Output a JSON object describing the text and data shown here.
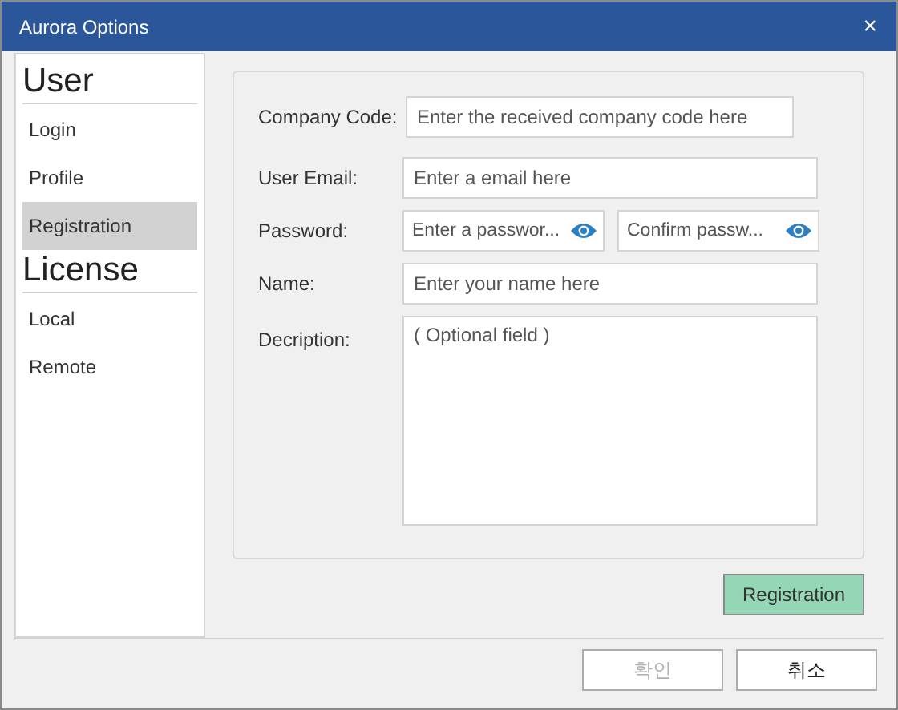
{
  "window": {
    "title": "Aurora Options",
    "close": "×"
  },
  "sidebar": {
    "sections": [
      {
        "header": "User",
        "items": [
          {
            "label": "Login",
            "selected": false
          },
          {
            "label": "Profile",
            "selected": false
          },
          {
            "label": "Registration",
            "selected": true
          }
        ]
      },
      {
        "header": "License",
        "items": [
          {
            "label": "Local",
            "selected": false
          },
          {
            "label": "Remote",
            "selected": false
          }
        ]
      }
    ]
  },
  "form": {
    "rows": [
      {
        "label": "Company Code:",
        "kind": "wide",
        "fields": [
          {
            "placeholder": "Enter the received company code here"
          }
        ]
      },
      {
        "label": "User Email:",
        "kind": "text",
        "fields": [
          {
            "placeholder": "Enter a email here"
          }
        ]
      },
      {
        "label": "Password:",
        "kind": "password",
        "fields": [
          {
            "placeholder": "Enter a passwor..."
          },
          {
            "placeholder": "Confirm passw..."
          }
        ]
      },
      {
        "label": "Name:",
        "kind": "text",
        "fields": [
          {
            "placeholder": "Enter your name here"
          }
        ]
      },
      {
        "label": "Decription:",
        "kind": "multiline",
        "fields": [
          {
            "placeholder": "( Optional field )"
          }
        ]
      }
    ],
    "submit": "Registration"
  },
  "buttons": [
    {
      "label": "확인",
      "disabled": true
    },
    {
      "label": "취소",
      "disabled": false
    }
  ]
}
